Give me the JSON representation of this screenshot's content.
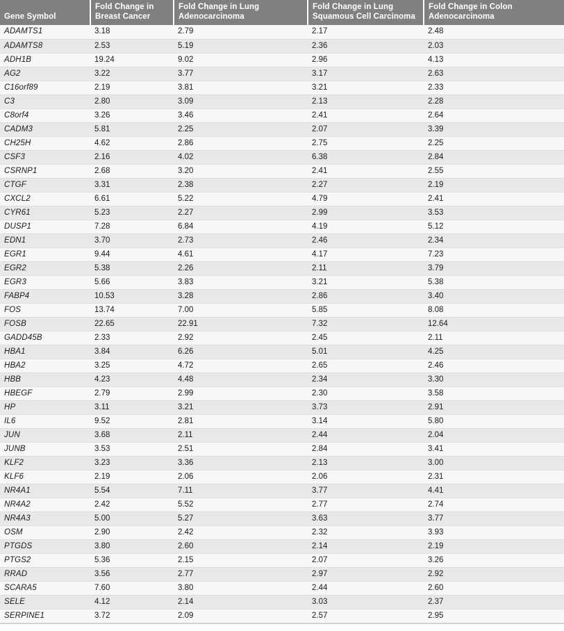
{
  "table": {
    "columns": [
      {
        "key": "gene",
        "label": "Gene Symbol"
      },
      {
        "key": "breast",
        "label": "Fold Change in Breast Cancer"
      },
      {
        "key": "luad",
        "label": "Fold Change in Lung Adenocarcinoma"
      },
      {
        "key": "lusc",
        "label": "Fold Change in Lung Squamous Cell Carcinoma"
      },
      {
        "key": "coad",
        "label": "Fold Change in Colon Adenocarcinoma"
      }
    ],
    "header_background": "#808080",
    "header_text_color": "#ffffff",
    "row_stripe_light": "#f7f7f7",
    "row_stripe_dark": "#e8e8e8",
    "rows": [
      {
        "gene": "ADAMTS1",
        "breast": "3.18",
        "luad": "2.79",
        "lusc": "2.17",
        "coad": "2.48"
      },
      {
        "gene": "ADAMTS8",
        "breast": "2.53",
        "luad": "5.19",
        "lusc": "2.36",
        "coad": "2.03"
      },
      {
        "gene": "ADH1B",
        "breast": "19.24",
        "luad": "9.02",
        "lusc": "2.96",
        "coad": "4.13"
      },
      {
        "gene": "AG2",
        "breast": "3.22",
        "luad": "3.77",
        "lusc": "3.17",
        "coad": "2.63"
      },
      {
        "gene": "C16orf89",
        "breast": "2.19",
        "luad": "3.81",
        "lusc": "3.21",
        "coad": "2.33"
      },
      {
        "gene": "C3",
        "breast": "2.80",
        "luad": "3.09",
        "lusc": "2.13",
        "coad": "2.28"
      },
      {
        "gene": "C8orf4",
        "breast": "3.26",
        "luad": "3.46",
        "lusc": "2.41",
        "coad": "2.64"
      },
      {
        "gene": "CADM3",
        "breast": "5.81",
        "luad": "2.25",
        "lusc": "2.07",
        "coad": "3.39"
      },
      {
        "gene": "CH25H",
        "breast": "4.62",
        "luad": "2.86",
        "lusc": "2.75",
        "coad": "2.25"
      },
      {
        "gene": "CSF3",
        "breast": "2.16",
        "luad": "4.02",
        "lusc": "6.38",
        "coad": "2.84"
      },
      {
        "gene": "CSRNP1",
        "breast": "2.68",
        "luad": "3.20",
        "lusc": "2.41",
        "coad": "2.55"
      },
      {
        "gene": "CTGF",
        "breast": "3.31",
        "luad": "2.38",
        "lusc": "2.27",
        "coad": "2.19"
      },
      {
        "gene": "CXCL2",
        "breast": "6.61",
        "luad": "5.22",
        "lusc": "4.79",
        "coad": "2.41"
      },
      {
        "gene": "CYR61",
        "breast": "5.23",
        "luad": "2.27",
        "lusc": "2.99",
        "coad": "3.53"
      },
      {
        "gene": "DUSP1",
        "breast": "7.28",
        "luad": "6.84",
        "lusc": "4.19",
        "coad": "5.12"
      },
      {
        "gene": "EDN1",
        "breast": "3.70",
        "luad": "2.73",
        "lusc": "2.46",
        "coad": "2.34"
      },
      {
        "gene": "EGR1",
        "breast": "9.44",
        "luad": "4.61",
        "lusc": "4.17",
        "coad": "7.23"
      },
      {
        "gene": "EGR2",
        "breast": "5.38",
        "luad": "2.26",
        "lusc": "2.11",
        "coad": "3.79"
      },
      {
        "gene": "EGR3",
        "breast": "5.66",
        "luad": "3.83",
        "lusc": "3.21",
        "coad": "5.38"
      },
      {
        "gene": "FABP4",
        "breast": "10.53",
        "luad": "3.28",
        "lusc": "2.86",
        "coad": "3.40"
      },
      {
        "gene": "FOS",
        "breast": "13.74",
        "luad": "7.00",
        "lusc": "5.85",
        "coad": "8.08"
      },
      {
        "gene": "FOSB",
        "breast": "22.65",
        "luad": "22.91",
        "lusc": "7.32",
        "coad": "12.64"
      },
      {
        "gene": "GADD45B",
        "breast": "2.33",
        "luad": "2.92",
        "lusc": "2.45",
        "coad": "2.11"
      },
      {
        "gene": "HBA1",
        "breast": "3.84",
        "luad": "6.26",
        "lusc": "5.01",
        "coad": "4.25"
      },
      {
        "gene": "HBA2",
        "breast": "3.25",
        "luad": "4.72",
        "lusc": "2.65",
        "coad": "2.46"
      },
      {
        "gene": "HBB",
        "breast": "4.23",
        "luad": "4.48",
        "lusc": "2.34",
        "coad": "3.30"
      },
      {
        "gene": "HBEGF",
        "breast": "2.79",
        "luad": "2.99",
        "lusc": "2.30",
        "coad": "3.58"
      },
      {
        "gene": "HP",
        "breast": "3.11",
        "luad": "3.21",
        "lusc": "3.73",
        "coad": "2.91"
      },
      {
        "gene": "IL6",
        "breast": "9.52",
        "luad": "2.81",
        "lusc": "3.14",
        "coad": "5.80"
      },
      {
        "gene": "JUN",
        "breast": "3.68",
        "luad": "2.11",
        "lusc": "2.44",
        "coad": "2.04"
      },
      {
        "gene": "JUNB",
        "breast": "3.53",
        "luad": "2.51",
        "lusc": "2.84",
        "coad": "3.41"
      },
      {
        "gene": "KLF2",
        "breast": "3.23",
        "luad": "3.36",
        "lusc": "2.13",
        "coad": "3.00"
      },
      {
        "gene": "KLF6",
        "breast": "2.19",
        "luad": "2.06",
        "lusc": "2.06",
        "coad": "2.31"
      },
      {
        "gene": "NR4A1",
        "breast": "5.54",
        "luad": "7.11",
        "lusc": "3.77",
        "coad": "4.41"
      },
      {
        "gene": "NR4A2",
        "breast": "2.42",
        "luad": "5.52",
        "lusc": "2.77",
        "coad": "2.74"
      },
      {
        "gene": "NR4A3",
        "breast": "5.00",
        "luad": "5.27",
        "lusc": "3.63",
        "coad": "3.77"
      },
      {
        "gene": "OSM",
        "breast": "2.90",
        "luad": "2.42",
        "lusc": "2.32",
        "coad": "3.93"
      },
      {
        "gene": "PTGDS",
        "breast": "3.80",
        "luad": "2.60",
        "lusc": "2.14",
        "coad": "2.19"
      },
      {
        "gene": "PTGS2",
        "breast": "5.36",
        "luad": "2.15",
        "lusc": "2.07",
        "coad": "3.26"
      },
      {
        "gene": "RRAD",
        "breast": "3.56",
        "luad": "2.77",
        "lusc": "2.97",
        "coad": "2.92"
      },
      {
        "gene": "SCARA5",
        "breast": "7.60",
        "luad": "3.80",
        "lusc": "2.44",
        "coad": "2.60"
      },
      {
        "gene": "SELE",
        "breast": "4.12",
        "luad": "2.14",
        "lusc": "3.03",
        "coad": "2.37"
      },
      {
        "gene": "SERPINE1",
        "breast": "3.72",
        "luad": "2.09",
        "lusc": "2.57",
        "coad": "2.95"
      }
    ]
  }
}
